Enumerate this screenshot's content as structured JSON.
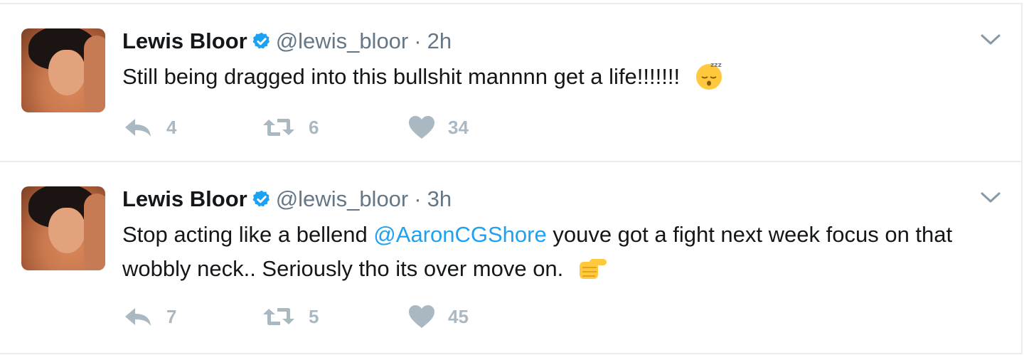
{
  "tweets": [
    {
      "author": "Lewis Bloor",
      "handle": "@lewis_bloor",
      "separator": "·",
      "time": "2h",
      "text_before": "Still being dragged into this bullshit mannnn get a life!!!!!!!",
      "mention": "",
      "text_after": "",
      "emoji": "sleeping-face-emoji",
      "replies": "4",
      "retweets": "6",
      "likes": "34"
    },
    {
      "author": "Lewis Bloor",
      "handle": "@lewis_bloor",
      "separator": "·",
      "time": "3h",
      "text_before": "Stop acting like a bellend ",
      "mention": "@AaronCGShore",
      "text_after": " youve got a fight next week focus on that wobbly neck.. Seriously tho its over move on.",
      "emoji": "thumbs-right-emoji",
      "replies": "7",
      "retweets": "5",
      "likes": "45"
    }
  ],
  "colors": {
    "text": "#14171a",
    "secondary": "#657786",
    "icon": "#aab8c2",
    "link": "#1da1f2",
    "verified": "#1da1f2",
    "border": "#e6ecf0"
  }
}
